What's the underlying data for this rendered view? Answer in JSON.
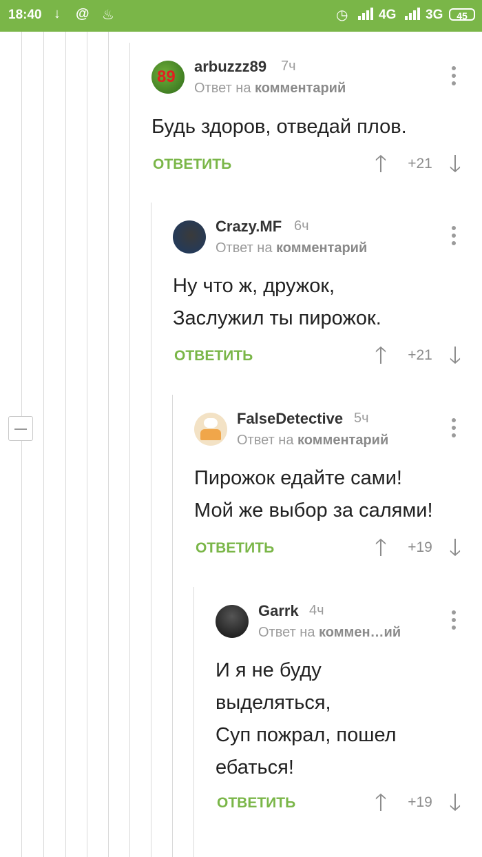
{
  "status_bar": {
    "time": "18:40",
    "download_icon": "↓",
    "at_icon": "@",
    "flame_icon": "♨",
    "alarm_icon": "◷",
    "network1": "4G",
    "network2": "3G",
    "battery": "45"
  },
  "comments": [
    {
      "username": "arbuzzz89",
      "time": "7ч",
      "reply_prefix": "Ответ на ",
      "reply_target": "комментарий",
      "text": "Будь здоров, отведай плов.",
      "reply_label": "ОТВЕТИТЬ",
      "votes": "+21",
      "avatar_badge": "89"
    },
    {
      "username": "Crazy.MF",
      "time": "6ч",
      "reply_prefix": "Ответ на ",
      "reply_target": "комментарий",
      "text": "Ну что ж, дружок,\nЗаслужил ты пирожок.",
      "reply_label": "ОТВЕТИТЬ",
      "votes": "+21"
    },
    {
      "username": "FalseDetective",
      "time": "5ч",
      "reply_prefix": "Ответ на ",
      "reply_target": "комментарий",
      "text": "Пирожок едайте сами!\nМой же выбор за салями!",
      "reply_label": "ОТВЕТИТЬ",
      "votes": "+19"
    },
    {
      "username": "Garrk",
      "time": "4ч",
      "reply_prefix": "Ответ на ",
      "reply_target": "коммен…ий",
      "text": "И я не буду\nвыделяться,\nСуп пожрал, пошел\nебаться!",
      "reply_label": "ОТВЕТИТЬ",
      "votes": "+19"
    }
  ],
  "icons": {
    "upvote": "🡑",
    "downvote": "🡓"
  },
  "colors": {
    "accent_green": "#7ab648",
    "muted_gray": "#9b9b9b"
  }
}
